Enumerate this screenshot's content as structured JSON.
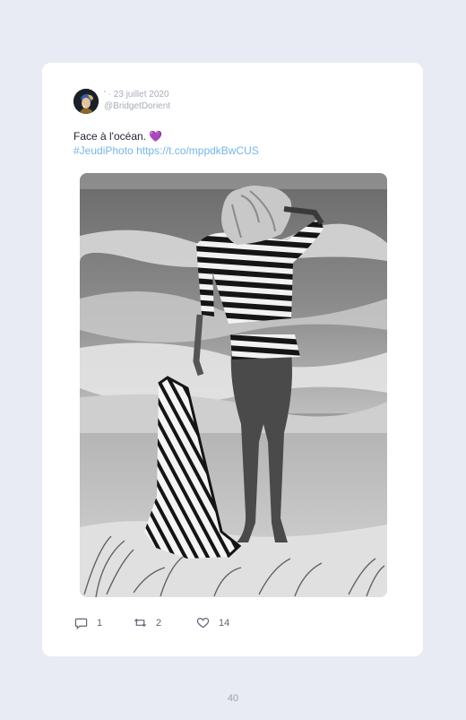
{
  "tweet": {
    "date": "' · 23 juillet 2020",
    "handle": "@BridgetDorient",
    "text": "Face à l'océan.",
    "heart_emoji": "💜",
    "hashtag": "#JeudiPhoto",
    "link": "https://t.co/mppdkBwCUS",
    "image_alt": "Black and white photo of a woman in a striped top standing on a beach facing the ocean, holding a striped towel"
  },
  "actions": {
    "replies": "1",
    "retweets": "2",
    "likes": "14"
  },
  "icons": {
    "reply": "reply-icon",
    "retweet": "retweet-icon",
    "like": "heart-icon"
  },
  "colors": {
    "link": "#76b6e6",
    "background": "#e8ebf3"
  },
  "page": {
    "number": "40"
  }
}
